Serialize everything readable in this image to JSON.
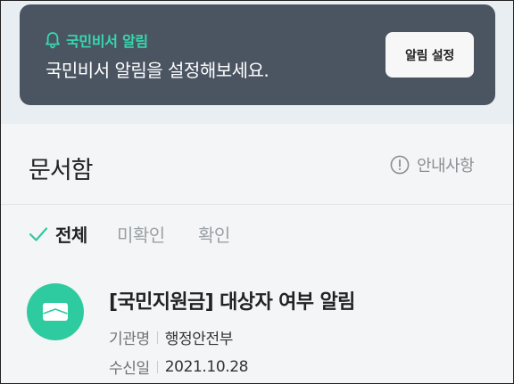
{
  "banner": {
    "title": "국민비서 알림",
    "message": "국민비서 알림을 설정해보세요.",
    "button_label": "알림 설정",
    "icon": "bell-icon",
    "title_color": "#35d9ad",
    "background": "#4b5562"
  },
  "section": {
    "title": "문서함",
    "notice_label": "안내사항",
    "notice_icon": "info-icon"
  },
  "tabs": [
    {
      "label": "전체",
      "selected": true,
      "icon": "check-icon"
    },
    {
      "label": "미확인",
      "selected": false
    },
    {
      "label": "확인",
      "selected": false
    }
  ],
  "documents": [
    {
      "title": "[국민지원금] 대상자 여부 알림",
      "icon": "envelope-icon",
      "icon_color": "#2ecaa0",
      "agency_label": "기관명",
      "agency": "행정안전부",
      "date_label": "수신일",
      "date": "2021.10.28"
    }
  ]
}
